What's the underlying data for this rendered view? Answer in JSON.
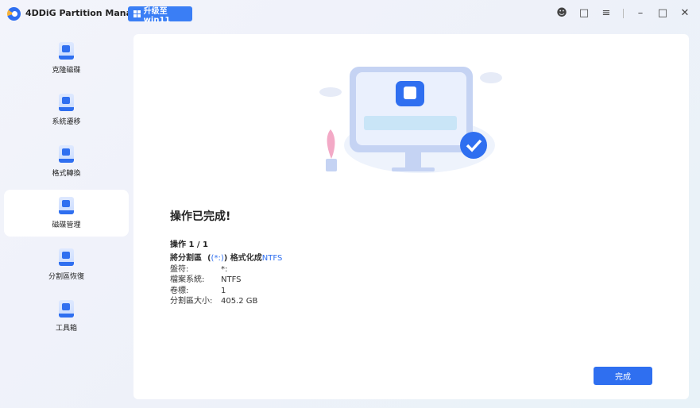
{
  "app": {
    "title": "4DDiG Partition Manager",
    "upgrade_label": "升级至win11"
  },
  "sidebar": {
    "items": [
      {
        "label": "克隆磁碟"
      },
      {
        "label": "系統遷移"
      },
      {
        "label": "格式轉換"
      },
      {
        "label": "磁碟管理",
        "active": true
      },
      {
        "label": "分割區恢復"
      },
      {
        "label": "工具箱"
      }
    ]
  },
  "main": {
    "title": "操作已完成!",
    "op_count": "操作 1 / 1",
    "summary": {
      "prefix": "將分割區",
      "drive": "(*:)",
      "action": "格式化成",
      "fs": "NTFS"
    },
    "details": [
      {
        "k": "盤符:",
        "v": "*:"
      },
      {
        "k": "檔案系統:",
        "v": "NTFS"
      },
      {
        "k": "卷標:",
        "v": "1"
      },
      {
        "k": "分割區大小:",
        "v": "405.2 GB"
      }
    ],
    "finish_label": "完成"
  },
  "colors": {
    "accent": "#2f6ff0"
  }
}
